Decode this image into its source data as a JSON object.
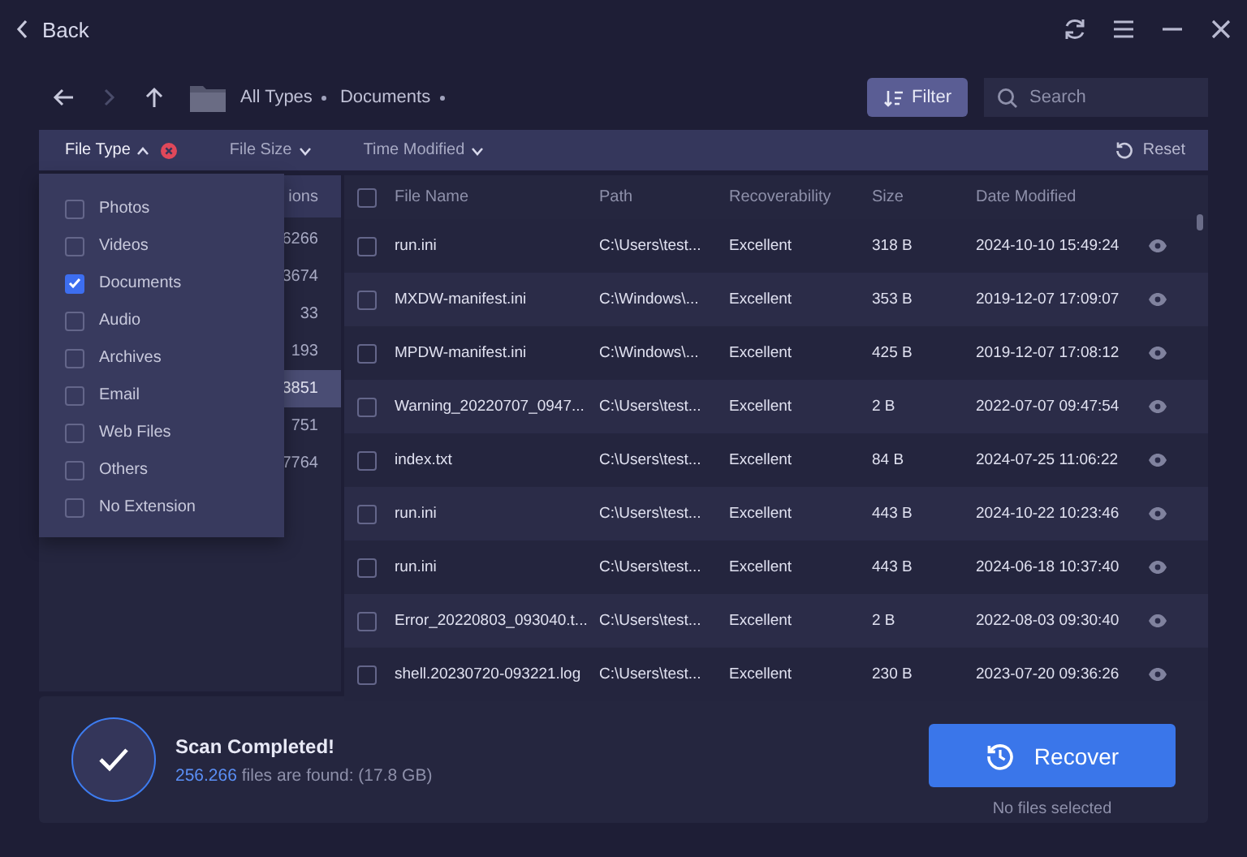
{
  "header": {
    "back": "Back"
  },
  "nav": {
    "breadcrumb": [
      "All Types",
      "Documents"
    ],
    "filter_button": "Filter",
    "search": {
      "placeholder": "Search"
    }
  },
  "filters": [
    {
      "label": "File Type",
      "expanded": true,
      "clearable": true
    },
    {
      "label": "File Size",
      "expanded": false,
      "clearable": false
    },
    {
      "label": "Time Modified",
      "expanded": false,
      "clearable": false
    }
  ],
  "reset": "Reset",
  "category_panel": {
    "header": "ions",
    "rows": [
      {
        "count": "6266",
        "selected": false
      },
      {
        "count": "3674",
        "selected": false
      },
      {
        "count": "33",
        "selected": false
      },
      {
        "count": "193",
        "selected": false
      },
      {
        "count": "3851",
        "selected": true
      },
      {
        "count": "751",
        "selected": false
      },
      {
        "count": "7764",
        "selected": false
      }
    ]
  },
  "file_type_menu": [
    {
      "label": "Photos",
      "checked": false
    },
    {
      "label": "Videos",
      "checked": false
    },
    {
      "label": "Documents",
      "checked": true
    },
    {
      "label": "Audio",
      "checked": false
    },
    {
      "label": "Archives",
      "checked": false
    },
    {
      "label": "Email",
      "checked": false
    },
    {
      "label": "Web Files",
      "checked": false
    },
    {
      "label": "Others",
      "checked": false
    },
    {
      "label": "No Extension",
      "checked": false
    }
  ],
  "table": {
    "all_checked": false,
    "columns": [
      "File Name",
      "Path",
      "Recoverability",
      "Size",
      "Date Modified"
    ],
    "rows": [
      {
        "checked": false,
        "name": "run.ini",
        "path": "C:\\Users\\test...",
        "recoverability": "Excellent",
        "size": "318 B",
        "date": "2024-10-10 15:49:24"
      },
      {
        "checked": false,
        "name": "MXDW-manifest.ini",
        "path": "C:\\Windows\\...",
        "recoverability": "Excellent",
        "size": "353 B",
        "date": "2019-12-07 17:09:07"
      },
      {
        "checked": false,
        "name": "MPDW-manifest.ini",
        "path": "C:\\Windows\\...",
        "recoverability": "Excellent",
        "size": "425 B",
        "date": "2019-12-07 17:08:12"
      },
      {
        "checked": false,
        "name": "Warning_20220707_0947...",
        "path": "C:\\Users\\test...",
        "recoverability": "Excellent",
        "size": "2 B",
        "date": "2022-07-07 09:47:54"
      },
      {
        "checked": false,
        "name": "index.txt",
        "path": "C:\\Users\\test...",
        "recoverability": "Excellent",
        "size": "84 B",
        "date": "2024-07-25 11:06:22"
      },
      {
        "checked": false,
        "name": "run.ini",
        "path": "C:\\Users\\test...",
        "recoverability": "Excellent",
        "size": "443 B",
        "date": "2024-10-22 10:23:46"
      },
      {
        "checked": false,
        "name": "run.ini",
        "path": "C:\\Users\\test...",
        "recoverability": "Excellent",
        "size": "443 B",
        "date": "2024-06-18 10:37:40"
      },
      {
        "checked": false,
        "name": "Error_20220803_093040.t...",
        "path": "C:\\Users\\test...",
        "recoverability": "Excellent",
        "size": "2 B",
        "date": "2022-08-03 09:30:40"
      },
      {
        "checked": false,
        "name": "shell.20230720-093221.log",
        "path": "C:\\Users\\test...",
        "recoverability": "Excellent",
        "size": "230 B",
        "date": "2023-07-20 09:36:26"
      }
    ]
  },
  "status": {
    "title": "Scan Completed!",
    "found_count": "256.266",
    "found_rest": "files are found: (17.8 GB)",
    "recover_button": "Recover",
    "note": "No files selected"
  }
}
